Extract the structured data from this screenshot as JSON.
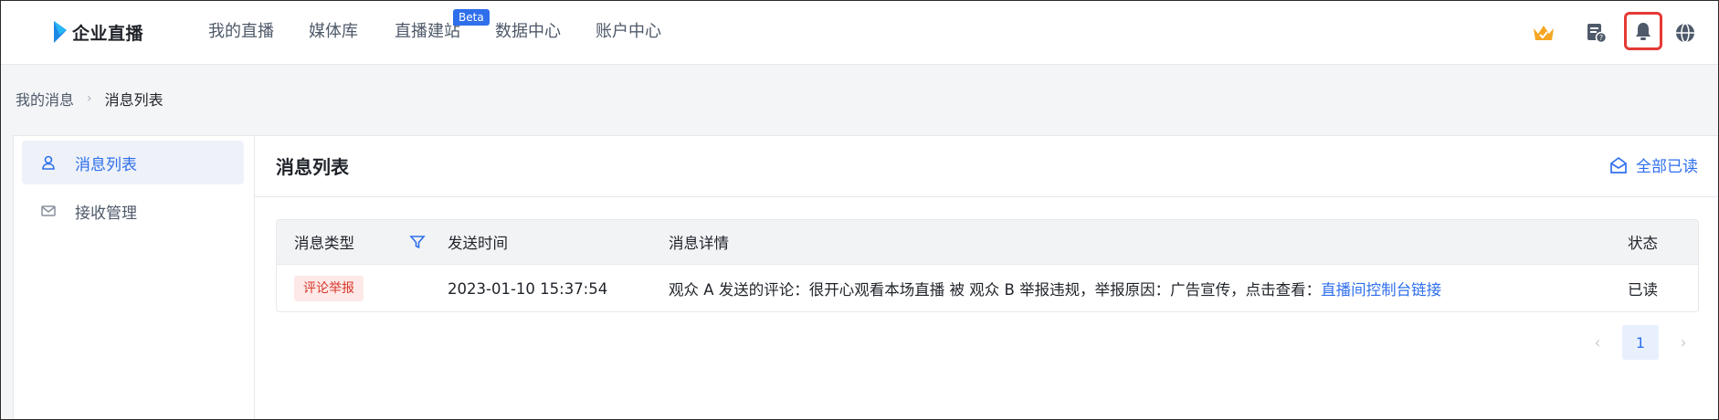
{
  "brand": {
    "name": "企业直播",
    "logo_icon": "play-triangle-logo",
    "accent": "#2f6fec"
  },
  "nav": {
    "items": [
      {
        "label": "我的直播"
      },
      {
        "label": "媒体库"
      },
      {
        "label": "直播建站"
      },
      {
        "label": "数据中心"
      },
      {
        "label": "账户中心"
      }
    ],
    "beta_badge": "Beta"
  },
  "header_icons": [
    "crown-icon",
    "help-doc-icon",
    "bell-icon",
    "globe-icon"
  ],
  "breadcrumb": {
    "parent": "我的消息",
    "current": "消息列表"
  },
  "sidebar": {
    "items": [
      {
        "label": "消息列表",
        "icon": "user-icon",
        "active": true
      },
      {
        "label": "接收管理",
        "icon": "mail-icon",
        "active": false
      }
    ]
  },
  "main": {
    "title": "消息列表",
    "mark_all_read": "全部已读"
  },
  "table": {
    "columns": [
      "消息类型",
      "发送时间",
      "消息详情",
      "状态"
    ],
    "rows": [
      {
        "type": "评论举报",
        "time": "2023-01-10 15:37:54",
        "detail_text": "观众 A 发送的评论：很开心观看本场直播 被 观众 B 举报违规，举报原因：广告宣传，点击查看：",
        "detail_link": "直播间控制台链接",
        "status": "已读"
      }
    ]
  },
  "pagination": {
    "current_page": "1",
    "prev": "‹",
    "next": "›"
  },
  "colors": {
    "highlight_border": "#e53935",
    "tag_bg": "#fde9e8",
    "tag_text": "#d9362b"
  }
}
